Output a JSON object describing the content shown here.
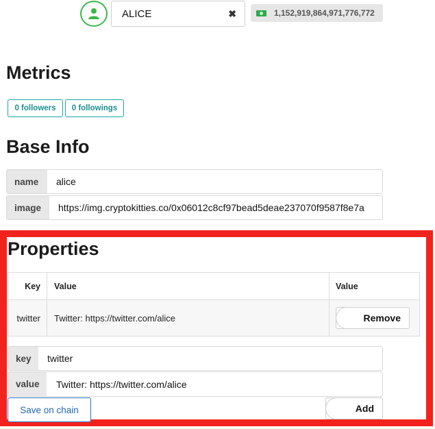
{
  "header": {
    "account_name": "ALICE",
    "clear_icon": "close-icon",
    "balance": "1,152,919,864,971,776,772",
    "colors": {
      "avatar_accent": "#3cb54a",
      "cash": "#2fa84f"
    }
  },
  "metrics": {
    "title": "Metrics",
    "followers_label": "0 followers",
    "followings_label": "0 followings"
  },
  "base_info": {
    "title": "Base Info",
    "name_label": "name",
    "name_value": "alice",
    "image_label": "image",
    "image_value": "https://img.cryptokitties.co/0x06012c8cf97bead5deae237070f9587f8e7a"
  },
  "properties": {
    "title": "Properties",
    "columns": [
      "Key",
      "Value",
      "Value"
    ],
    "rows": [
      {
        "key": "twitter",
        "value": "Twitter: https://twitter.com/alice",
        "action": "Remove"
      }
    ],
    "key_label": "key",
    "key_input": "twitter",
    "value_label": "value",
    "value_input": "Twitter: https://twitter.com/alice",
    "save_label": "Save on chain",
    "add_label": "Add",
    "highlight_color": "#f2231d"
  }
}
